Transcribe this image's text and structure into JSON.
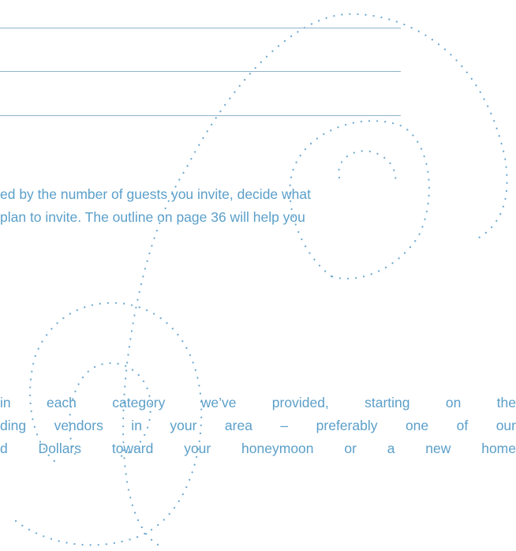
{
  "document": {
    "paragraph_1": {
      "lines": [
        "ed by the number of guests you invite, decide what",
        "plan to invite. The outline on page 36 will help you"
      ]
    },
    "paragraph_2": {
      "lines": [
        "in each category we’ve provided, starting on the",
        "ding vendors in your area – preferably one of our",
        "d Dollars toward your honeymoon or a new home"
      ]
    }
  },
  "colors": {
    "text": "#5b9fc9",
    "rules": "#8fb4cc",
    "swirl_dots": "#6fa9cf"
  }
}
